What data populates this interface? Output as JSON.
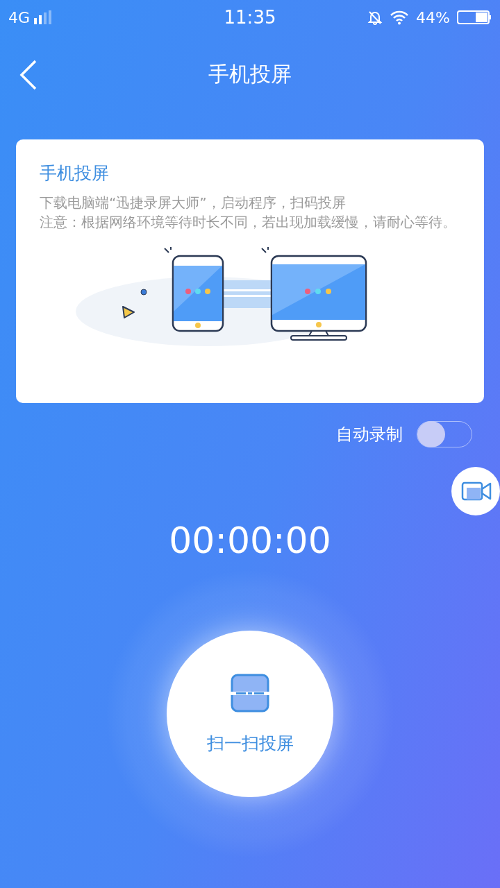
{
  "status_bar": {
    "network": "4G",
    "time": "11:35",
    "battery": "44%"
  },
  "header": {
    "title": "手机投屏"
  },
  "card": {
    "title": "手机投屏",
    "lines": [
      "下载电脑端“迅捷录屏大师”，启动程序，扫码投屏",
      "注意：根据网络环境等待时长不同，若出现加载缓慢，请耐心等待。"
    ]
  },
  "auto_record": {
    "label": "自动录制",
    "on": false
  },
  "timer": "00:00:00",
  "scan_button": {
    "label": "扫一扫投屏"
  }
}
